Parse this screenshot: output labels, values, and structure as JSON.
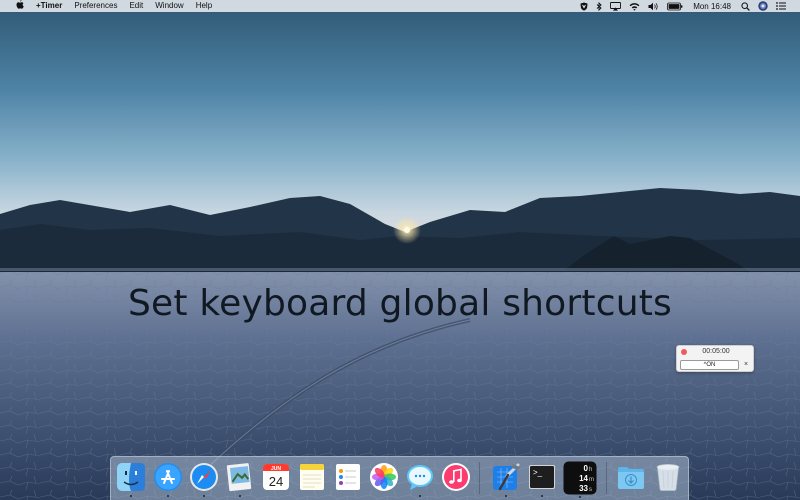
{
  "menubar": {
    "apple": "",
    "app_name": "+Timer",
    "menus": [
      "Preferences",
      "Edit",
      "Window",
      "Help"
    ],
    "clock": "Mon 16:48",
    "status_icons": [
      "vpn-shield-icon",
      "bluetooth-icon",
      "airplay-icon",
      "wifi-icon",
      "volume-icon",
      "battery-icon",
      "spotlight-search-icon",
      "user-avatar-icon",
      "notification-center-icon"
    ]
  },
  "headline": "Set keyboard global shortcuts",
  "timer_widget": {
    "time": "00:05:00",
    "shortcut": "^ON",
    "clear": "×",
    "record_color": "#f05a5a"
  },
  "dock": {
    "apps": [
      {
        "name": "Finder",
        "icon": "finder-icon",
        "running": true
      },
      {
        "name": "App Store",
        "icon": "app-store-icon",
        "running": true
      },
      {
        "name": "Safari",
        "icon": "safari-icon",
        "running": true
      },
      {
        "name": "Preview",
        "icon": "preview-icon",
        "running": true
      },
      {
        "name": "Calendar",
        "icon": "calendar-icon",
        "running": false,
        "month": "JUN",
        "day": "24"
      },
      {
        "name": "Notes",
        "icon": "notes-icon",
        "running": false
      },
      {
        "name": "Reminders",
        "icon": "reminders-icon",
        "running": false
      },
      {
        "name": "Photos",
        "icon": "photos-icon",
        "running": false
      },
      {
        "name": "Messages",
        "icon": "messages-icon",
        "running": true
      },
      {
        "name": "iTunes",
        "icon": "itunes-icon",
        "running": false
      },
      {
        "name": "Xcode",
        "icon": "xcode-icon",
        "running": true
      },
      {
        "name": "Terminal",
        "icon": "terminal-icon",
        "running": true,
        "prompt": ">_"
      },
      {
        "name": "+Timer",
        "icon": "timer-app-icon",
        "running": true,
        "hours": "0",
        "minutes": "14",
        "seconds": "33",
        "h_unit": "h",
        "m_unit": "m",
        "s_unit": "s"
      },
      {
        "name": "Downloads",
        "icon": "downloads-folder-icon",
        "running": false
      },
      {
        "name": "Trash",
        "icon": "trash-icon",
        "running": false
      }
    ]
  }
}
